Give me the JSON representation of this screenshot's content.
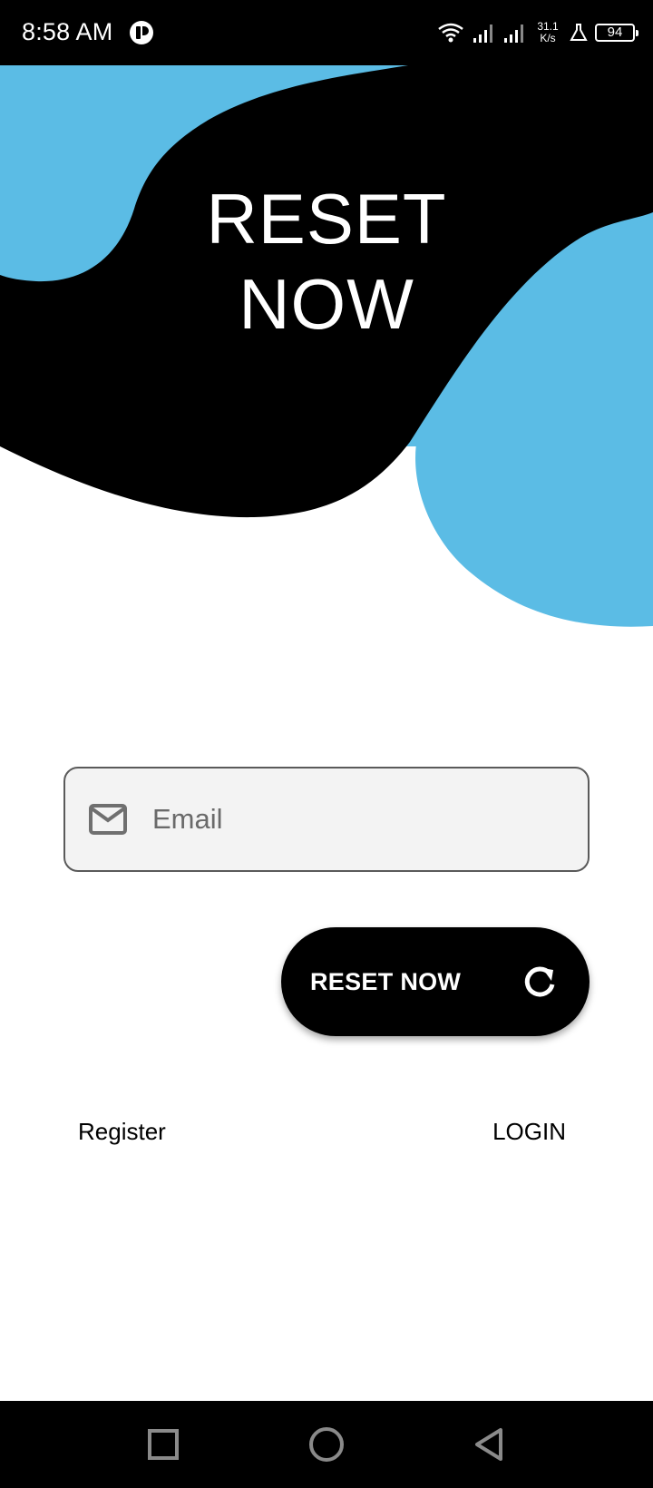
{
  "status_bar": {
    "time": "8:58 AM",
    "net_speed_value": "31.1",
    "net_speed_unit": "K/s",
    "battery": "94"
  },
  "hero": {
    "title_line1": "RESET",
    "title_line2": "NOW",
    "colors": {
      "blob_black": "#000000",
      "blob_blue": "#5bbce5"
    }
  },
  "form": {
    "email_placeholder": "Email",
    "email_icon": "mail-icon"
  },
  "reset_button": {
    "label": "RESET NOW",
    "icon": "refresh-icon"
  },
  "links": {
    "register": "Register",
    "login": "LOGIN"
  },
  "nav": {
    "recent_icon": "square-icon",
    "home_icon": "circle-icon",
    "back_icon": "triangle-back-icon"
  }
}
